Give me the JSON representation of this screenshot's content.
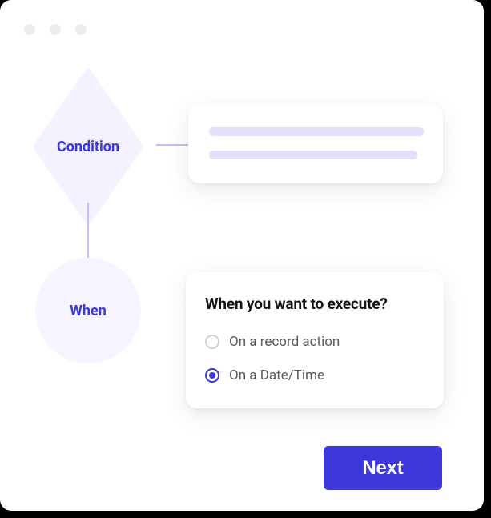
{
  "flow": {
    "condition_label": "Condition",
    "when_label": "When"
  },
  "when_card": {
    "title": "When you want to execute?",
    "options": [
      {
        "label": "On a record action",
        "selected": false
      },
      {
        "label": "On a Date/Time",
        "selected": true
      }
    ]
  },
  "next_button_label": "Next"
}
